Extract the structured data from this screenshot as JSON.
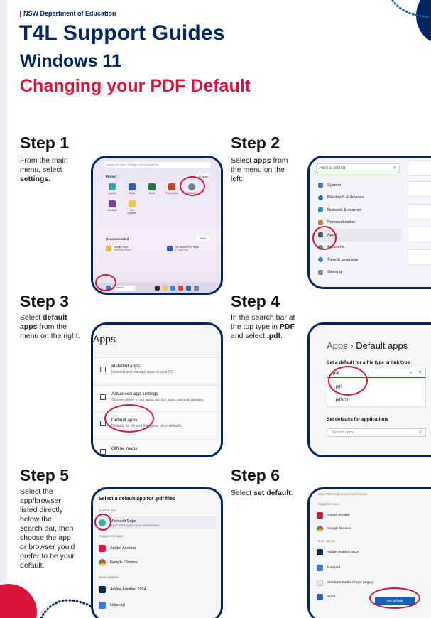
{
  "header": {
    "org": "NSW Department of Education",
    "title": "T4L Support Guides",
    "subtitle": "Windows 11",
    "topic": "Changing your PDF Default"
  },
  "colors": {
    "navy": "#002664",
    "red": "#d7153a",
    "blue": "#1a5fb4"
  },
  "steps": [
    {
      "heading": "Step 1",
      "text_pre": "From the main menu, select ",
      "bold": "settings",
      "text_post": "."
    },
    {
      "heading": "Step 2",
      "text_pre": "Select ",
      "bold": "apps",
      "text_post": " from the menu on the left."
    },
    {
      "heading": "Step 3",
      "text_pre": "Select ",
      "bold": "default apps",
      "text_post": " from the menu on the right."
    },
    {
      "heading": "Step 4",
      "text_pre": "In the search bar at the top type in ",
      "bold": "PDF",
      "text_mid": " and select ",
      "bold2": ".pdf",
      "text_post": "."
    },
    {
      "heading": "Step 5",
      "text_pre": "Select the app/browser listed directly below the search bar, then choose the app or browser you'd prefer to be your default.",
      "bold": "",
      "text_post": ""
    },
    {
      "heading": "Step 6",
      "text_pre": "Select ",
      "bold": "set default",
      "text_post": "."
    }
  ],
  "screen1": {
    "search_placeholder": "Search for apps, settings, and documents",
    "pinned": "Pinned",
    "all_apps": "All apps",
    "apps": [
      "Copilot",
      "Word",
      "Excel",
      "PowerPoint",
      "Settings",
      "OneNote",
      "File Explorer"
    ],
    "recommended": "Recommended",
    "more": "More",
    "rec_items": [
      {
        "name": "Google Drive",
        "sub": "Recently added"
      },
      {
        "name": "T4L Adobe PDF Page",
        "sub": "27 days ago"
      }
    ],
    "taskbar_search": "Search"
  },
  "screen2": {
    "search_placeholder": "Find a setting",
    "items": [
      "System",
      "Bluetooth & devices",
      "Network & internet",
      "Personalization",
      "Apps",
      "Accounts",
      "Time & language",
      "Gaming"
    ],
    "selected": "Apps"
  },
  "screen3": {
    "title": "Apps",
    "rows": [
      {
        "h": "Installed apps",
        "d": "Uninstall and manage apps on your PC"
      },
      {
        "h": "Advanced app settings",
        "d": "Choose where to get apps, archive apps, uninstall updates"
      },
      {
        "h": "Default apps",
        "d": "Defaults for file and link types, other defaults"
      },
      {
        "h": "Offline maps",
        "d": ""
      }
    ]
  },
  "screen4": {
    "crumb_parent": "Apps",
    "crumb_sep": "›",
    "crumb_current": "Default apps",
    "set_label": "Set a default for a file type or link type",
    "input_value": ".pdf",
    "options": [
      ".pdf",
      ".pdfxml"
    ],
    "apps_label": "Set defaults for applications",
    "apps_placeholder": "Search apps"
  },
  "screen5": {
    "title": "Select a default app for .pdf files",
    "default_app": "Default app",
    "current": {
      "name": "Microsoft Edge",
      "sub": "Open PDFs right in your web browser"
    },
    "suggested": "Suggested apps",
    "suggested_items": [
      "Adobe Acrobat",
      "Google Chrome"
    ],
    "more": "More options",
    "more_items": [
      "Adobe Audition 2024",
      "Notepad"
    ]
  },
  "screen6": {
    "top_text": "Open PDFs right in your web browser",
    "suggested": "Suggested apps",
    "suggested_items": [
      "Adobe Acrobat",
      "Google Chrome"
    ],
    "more": "More options",
    "more_items": [
      "Adobe Audition 2024",
      "Notepad",
      "Windows Media Player Legacy",
      "Word"
    ],
    "button": "Set default"
  }
}
